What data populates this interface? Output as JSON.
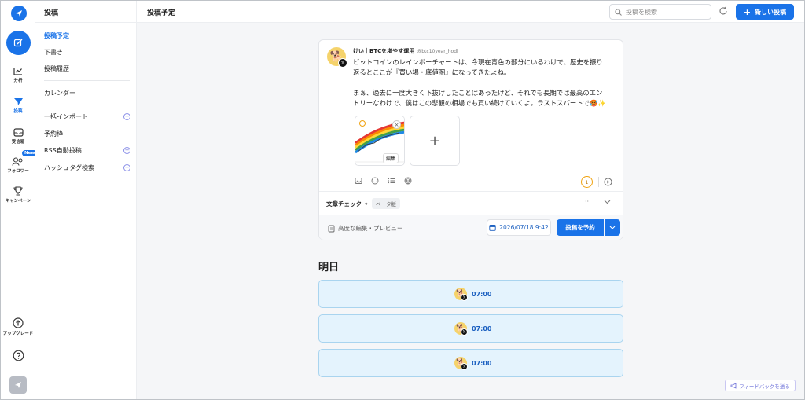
{
  "rail": {
    "items": [
      {
        "label": "分析",
        "icon": "chart-line-icon"
      },
      {
        "label": "投稿",
        "icon": "send-icon"
      },
      {
        "label": "受信箱",
        "icon": "inbox-icon"
      },
      {
        "label": "フォロワー",
        "icon": "followers-icon",
        "badge": "New"
      },
      {
        "label": "キャンペーン",
        "icon": "trophy-icon"
      }
    ],
    "upgrade_label": "アップグレード"
  },
  "side": {
    "title": "投稿",
    "items": [
      "投稿予定",
      "下書き",
      "投稿履歴",
      "カレンダー",
      "一括インポート",
      "予約枠",
      "RSS自動投稿",
      "ハッシュタグ検索"
    ]
  },
  "topbar": {
    "title": "投稿予定",
    "search_placeholder": "投稿を検索",
    "new_post": "新しい投稿"
  },
  "post": {
    "author": "けい｜BTCを増やす運用",
    "handle": "@btc10year_hodl",
    "line1": "ビットコインのレインボーチャートは、今現在青色の部分にいるわけで、歴史を振り",
    "line2": "返るとここが『買い場・底値圏』になってきたよね。",
    "line3": "まぁ、過去に一度大きく下抜けしたことはあったけど、それでも長期では最高のエン",
    "line4": "トリーなわけで、僕はこの悲観の相場でも買い続けていくよ。ラストスパートで🥵✨",
    "thumb_edit": "編集",
    "char_counter": "1",
    "check_label": "文章チェック",
    "beta": "ベータ版",
    "advanced_edit": "高度な編集・プレビュー",
    "date": "2026/07/18 9:42",
    "schedule": "投稿を予約"
  },
  "tomorrow": {
    "heading": "明日",
    "slots": [
      "07:00",
      "07:00",
      "07:00"
    ]
  },
  "feedback": "フィードバックを送る",
  "colors": {
    "accent": "#1a73e8",
    "slot_bg": "#e4f3fd",
    "counter": "#f0a20f"
  }
}
